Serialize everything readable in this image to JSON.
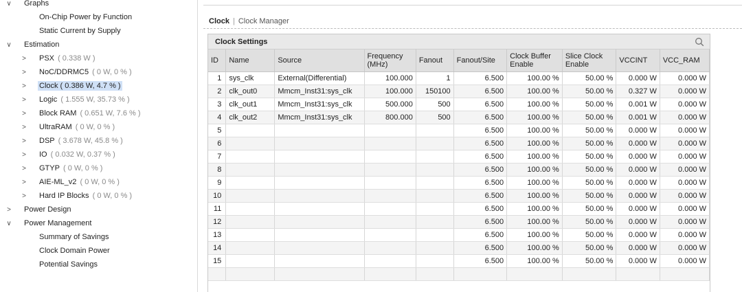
{
  "tree": [
    {
      "label": "Graphs",
      "value": "",
      "indent": 0,
      "chevron": "down"
    },
    {
      "label": "On-Chip Power by Function",
      "value": "",
      "indent": 2,
      "chevron": ""
    },
    {
      "label": "Static Current by Supply",
      "value": "",
      "indent": 2,
      "chevron": ""
    },
    {
      "label": "Estimation",
      "value": "",
      "indent": 0,
      "chevron": "down"
    },
    {
      "label": "PSX",
      "value": " ( 0.338 W )",
      "indent": 1,
      "chevron": "right"
    },
    {
      "label": "NoC/DDRMC5",
      "value": " ( 0 W, 0 % )",
      "indent": 1,
      "chevron": "right"
    },
    {
      "label": "Clock ( 0.386 W, 4.7 % )",
      "value": "",
      "indent": 1,
      "chevron": "right",
      "selected": true
    },
    {
      "label": "Logic",
      "value": " ( 1.555 W, 35.73 % )",
      "indent": 1,
      "chevron": "right"
    },
    {
      "label": "Block RAM",
      "value": " ( 0.651 W, 7.6 % )",
      "indent": 1,
      "chevron": "right"
    },
    {
      "label": "UltraRAM",
      "value": " ( 0 W, 0 % )",
      "indent": 1,
      "chevron": "right"
    },
    {
      "label": "DSP",
      "value": " ( 3.678 W, 45.8 % )",
      "indent": 1,
      "chevron": "right"
    },
    {
      "label": "IO",
      "value": " ( 0.032 W, 0.37 % )",
      "indent": 1,
      "chevron": "right"
    },
    {
      "label": "GTYP",
      "value": " ( 0 W, 0 % )",
      "indent": 1,
      "chevron": "right"
    },
    {
      "label": "AIE-ML_v2",
      "value": " ( 0 W, 0 % )",
      "indent": 1,
      "chevron": "right"
    },
    {
      "label": "Hard IP Blocks",
      "value": " ( 0 W, 0 % )",
      "indent": 1,
      "chevron": "right"
    },
    {
      "label": "Power Design",
      "value": "",
      "indent": 0,
      "chevron": "right"
    },
    {
      "label": "Power Management",
      "value": "",
      "indent": 0,
      "chevron": "down"
    },
    {
      "label": "Summary of Savings",
      "value": "",
      "indent": 2,
      "chevron": ""
    },
    {
      "label": "Clock Domain Power",
      "value": "",
      "indent": 2,
      "chevron": ""
    },
    {
      "label": "Potential Savings",
      "value": "",
      "indent": 2,
      "chevron": ""
    }
  ],
  "breadcrumb": {
    "current": "Clock",
    "separator": "|",
    "link": "Clock Manager"
  },
  "panel": {
    "title": "Clock Settings",
    "search_icon": "search-icon",
    "columns": [
      {
        "label": "ID"
      },
      {
        "label": "Name"
      },
      {
        "label": "Source"
      },
      {
        "label": "Frequency (MHz)"
      },
      {
        "label": "Fanout"
      },
      {
        "label": "Fanout/Site"
      },
      {
        "label": "Clock Buffer Enable"
      },
      {
        "label": "Slice Clock Enable"
      },
      {
        "label": "VCCINT"
      },
      {
        "label": "VCC_RAM"
      }
    ],
    "rows": [
      [
        "1",
        "sys_clk",
        "External(Differential)",
        "100.000",
        "1",
        "6.500",
        "100.00 %",
        "50.00 %",
        "0.000 W",
        "0.000 W"
      ],
      [
        "2",
        "clk_out0",
        "Mmcm_Inst31:sys_clk",
        "100.000",
        "150100",
        "6.500",
        "100.00 %",
        "50.00 %",
        "0.327 W",
        "0.000 W"
      ],
      [
        "3",
        "clk_out1",
        "Mmcm_Inst31:sys_clk",
        "500.000",
        "500",
        "6.500",
        "100.00 %",
        "50.00 %",
        "0.001 W",
        "0.000 W"
      ],
      [
        "4",
        "clk_out2",
        "Mmcm_Inst31:sys_clk",
        "800.000",
        "500",
        "6.500",
        "100.00 %",
        "50.00 %",
        "0.001 W",
        "0.000 W"
      ],
      [
        "5",
        "",
        "",
        "",
        "",
        "6.500",
        "100.00 %",
        "50.00 %",
        "0.000 W",
        "0.000 W"
      ],
      [
        "6",
        "",
        "",
        "",
        "",
        "6.500",
        "100.00 %",
        "50.00 %",
        "0.000 W",
        "0.000 W"
      ],
      [
        "7",
        "",
        "",
        "",
        "",
        "6.500",
        "100.00 %",
        "50.00 %",
        "0.000 W",
        "0.000 W"
      ],
      [
        "8",
        "",
        "",
        "",
        "",
        "6.500",
        "100.00 %",
        "50.00 %",
        "0.000 W",
        "0.000 W"
      ],
      [
        "9",
        "",
        "",
        "",
        "",
        "6.500",
        "100.00 %",
        "50.00 %",
        "0.000 W",
        "0.000 W"
      ],
      [
        "10",
        "",
        "",
        "",
        "",
        "6.500",
        "100.00 %",
        "50.00 %",
        "0.000 W",
        "0.000 W"
      ],
      [
        "11",
        "",
        "",
        "",
        "",
        "6.500",
        "100.00 %",
        "50.00 %",
        "0.000 W",
        "0.000 W"
      ],
      [
        "12",
        "",
        "",
        "",
        "",
        "6.500",
        "100.00 %",
        "50.00 %",
        "0.000 W",
        "0.000 W"
      ],
      [
        "13",
        "",
        "",
        "",
        "",
        "6.500",
        "100.00 %",
        "50.00 %",
        "0.000 W",
        "0.000 W"
      ],
      [
        "14",
        "",
        "",
        "",
        "",
        "6.500",
        "100.00 %",
        "50.00 %",
        "0.000 W",
        "0.000 W"
      ],
      [
        "15",
        "",
        "",
        "",
        "",
        "6.500",
        "100.00 %",
        "50.00 %",
        "0.000 W",
        "0.000 W"
      ],
      [
        "",
        "",
        "",
        "",
        "",
        "",
        "",
        "",
        "",
        ""
      ]
    ]
  }
}
